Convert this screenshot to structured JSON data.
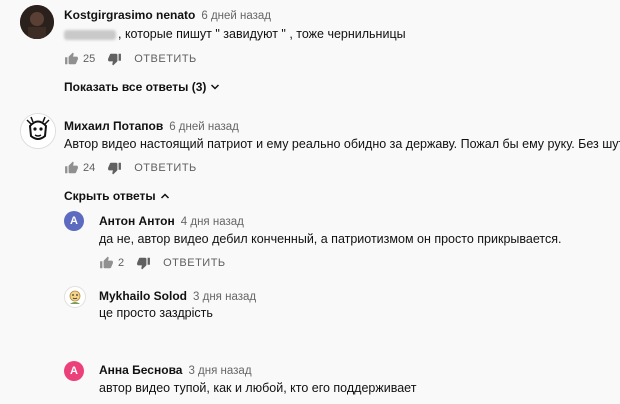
{
  "comments": [
    {
      "author": "Kostgirgrasimo nenato",
      "time": "6 дней назад",
      "text": ", которые пишут \" завидуют \" , тоже чернильницы",
      "likes": "25",
      "reply": "ОТВЕТИТЬ",
      "show_replies": "Показать все ответы (3)"
    },
    {
      "author": "Михаил Потапов",
      "time": "6 дней назад",
      "text": "Автор видео настоящий патриот и ему реально обидно за державу. Пожал бы ему руку. Без шуток.",
      "likes": "24",
      "reply": "ОТВЕТИТЬ",
      "hide_replies": "Скрыть ответы"
    }
  ],
  "replies": [
    {
      "avatar_letter": "A",
      "avatar_color": "#5c6bc0",
      "author": "Антон Антон",
      "time": "4 дня назад",
      "text": "да не, автор видео дебил конченный, а патриотизмом он просто прикрывается.",
      "likes": "2",
      "reply": "ОТВЕТИТЬ"
    },
    {
      "author": "Mykhailo Solod",
      "time": "3 дня назад",
      "text": "це просто заздрість"
    },
    {
      "avatar_letter": "A",
      "avatar_color": "#ec407a",
      "author": "Анна Беснова",
      "time": "3 дня назад",
      "text": "автор видео тупой, как и любой, кто его поддерживает"
    }
  ],
  "icons": {
    "like": "thumbs-up-icon",
    "dislike": "thumbs-down-icon",
    "chevron_down": "chevron-down-icon",
    "chevron_up": "chevron-up-icon"
  }
}
